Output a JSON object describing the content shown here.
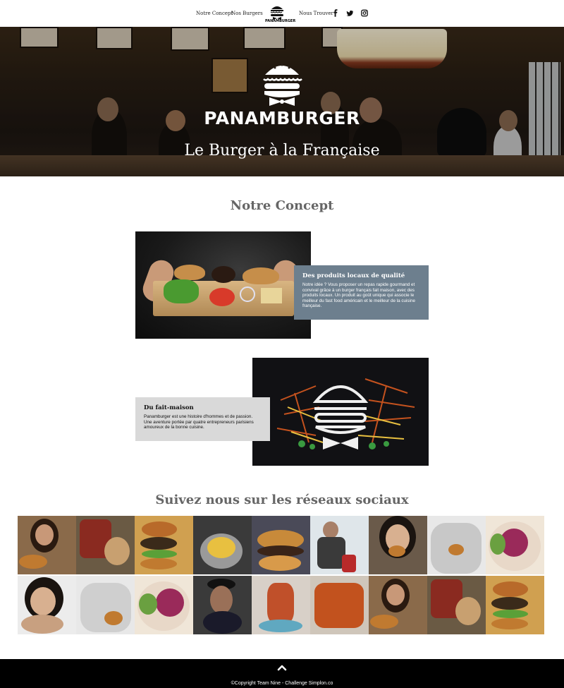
{
  "nav": {
    "links": [
      {
        "label": "Notre Concept"
      },
      {
        "label": "Nos Burgers"
      },
      {
        "label": "Nous Trouver"
      }
    ],
    "logo_text": "PANAMBURGER",
    "social": [
      "facebook-icon",
      "twitter-icon",
      "instagram-icon"
    ]
  },
  "hero": {
    "brand": "PANAMBURGER",
    "tagline": "Le Burger à la Française"
  },
  "concept": {
    "title": "Notre Concept",
    "blocks": [
      {
        "title": "Des produits locaux de qualité",
        "text": "Notre idée ? Vous proposer un repas rapide gourmand et convival grâce à un burger français fait maison, avec des produits locaux. Un produit au goût unique qui associe le meilleur du fast food américain et le meilleur de la cuisine française."
      },
      {
        "title": "Du fait-maison",
        "text": "Panamburger est une histoire d'hommes et de passion. Une aventure portée par quatre entrepreneurs parisiens amoureux de la bonne cuisine."
      }
    ]
  },
  "social_section": {
    "title": "Suivez nous sur les réseaux sociaux",
    "tile_count": 18
  },
  "footer": {
    "copyright": "©Copyright Team Nine - Challenge Simplon.co"
  },
  "colors": {
    "concept_box_blue": "#6d7f8e",
    "concept_box_grey": "#d9d9d9",
    "footer": "#000000",
    "title_grey": "#666666"
  }
}
